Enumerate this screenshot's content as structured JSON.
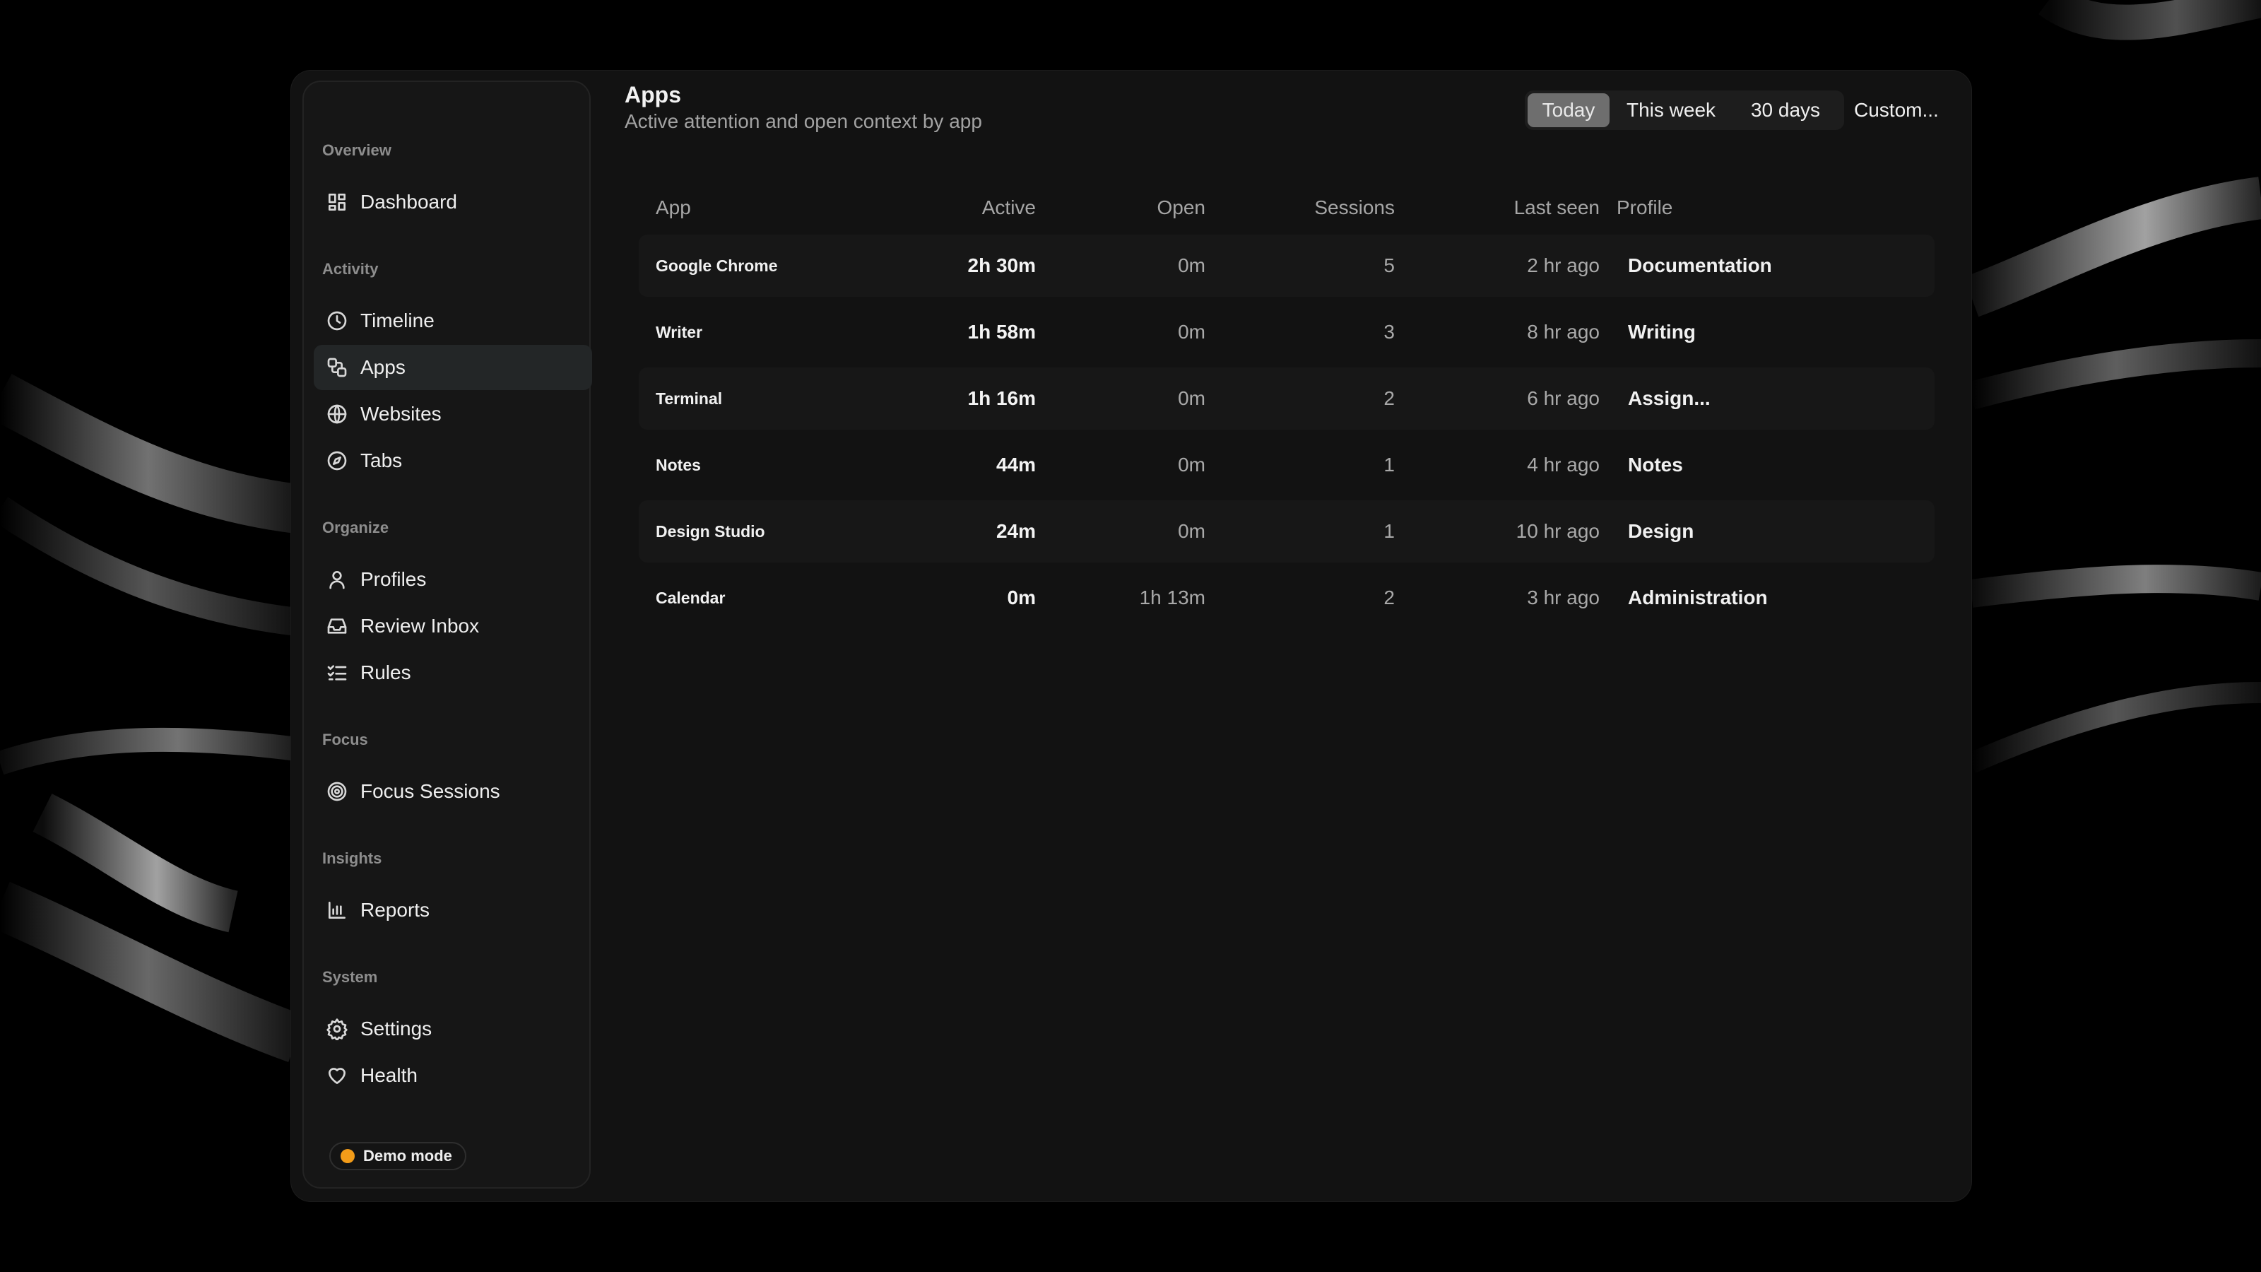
{
  "sidebar": {
    "sections": [
      {
        "title": "Overview",
        "items": [
          {
            "label": "Dashboard",
            "icon": "dashboard-icon"
          }
        ]
      },
      {
        "title": "Activity",
        "items": [
          {
            "label": "Timeline",
            "icon": "clock-icon"
          },
          {
            "label": "Apps",
            "icon": "apps-icon",
            "active": true
          },
          {
            "label": "Websites",
            "icon": "globe-icon"
          },
          {
            "label": "Tabs",
            "icon": "compass-icon"
          }
        ]
      },
      {
        "title": "Organize",
        "items": [
          {
            "label": "Profiles",
            "icon": "user-icon"
          },
          {
            "label": "Review Inbox",
            "icon": "inbox-icon"
          },
          {
            "label": "Rules",
            "icon": "checklist-icon"
          }
        ]
      },
      {
        "title": "Focus",
        "items": [
          {
            "label": "Focus Sessions",
            "icon": "target-icon"
          }
        ]
      },
      {
        "title": "Insights",
        "items": [
          {
            "label": "Reports",
            "icon": "bar-chart-icon"
          }
        ]
      },
      {
        "title": "System",
        "items": [
          {
            "label": "Settings",
            "icon": "gear-icon"
          },
          {
            "label": "Health",
            "icon": "heart-icon"
          }
        ]
      }
    ],
    "demo_badge": "Demo mode",
    "demo_color": "#f39c19"
  },
  "header": {
    "title": "Apps",
    "subtitle": "Active attention and open context by app",
    "ranges": [
      "Today",
      "This week",
      "30 days"
    ],
    "active_range": "Today",
    "custom_label": "Custom..."
  },
  "table": {
    "columns": [
      "App",
      "Active",
      "Open",
      "Sessions",
      "Last seen",
      "Profile"
    ],
    "rows": [
      {
        "app": "Google Chrome",
        "active": "2h 30m",
        "open": "0m",
        "sessions": "5",
        "last_seen": "2 hr ago",
        "profile": "Documentation"
      },
      {
        "app": "Writer",
        "active": "1h 58m",
        "open": "0m",
        "sessions": "3",
        "last_seen": "8 hr ago",
        "profile": "Writing"
      },
      {
        "app": "Terminal",
        "active": "1h 16m",
        "open": "0m",
        "sessions": "2",
        "last_seen": "6 hr ago",
        "profile": "Assign..."
      },
      {
        "app": "Notes",
        "active": "44m",
        "open": "0m",
        "sessions": "1",
        "last_seen": "4 hr ago",
        "profile": "Notes"
      },
      {
        "app": "Design Studio",
        "active": "24m",
        "open": "0m",
        "sessions": "1",
        "last_seen": "10 hr ago",
        "profile": "Design"
      },
      {
        "app": "Calendar",
        "active": "0m",
        "open": "1h 13m",
        "sessions": "2",
        "last_seen": "3 hr ago",
        "profile": "Administration"
      }
    ]
  }
}
